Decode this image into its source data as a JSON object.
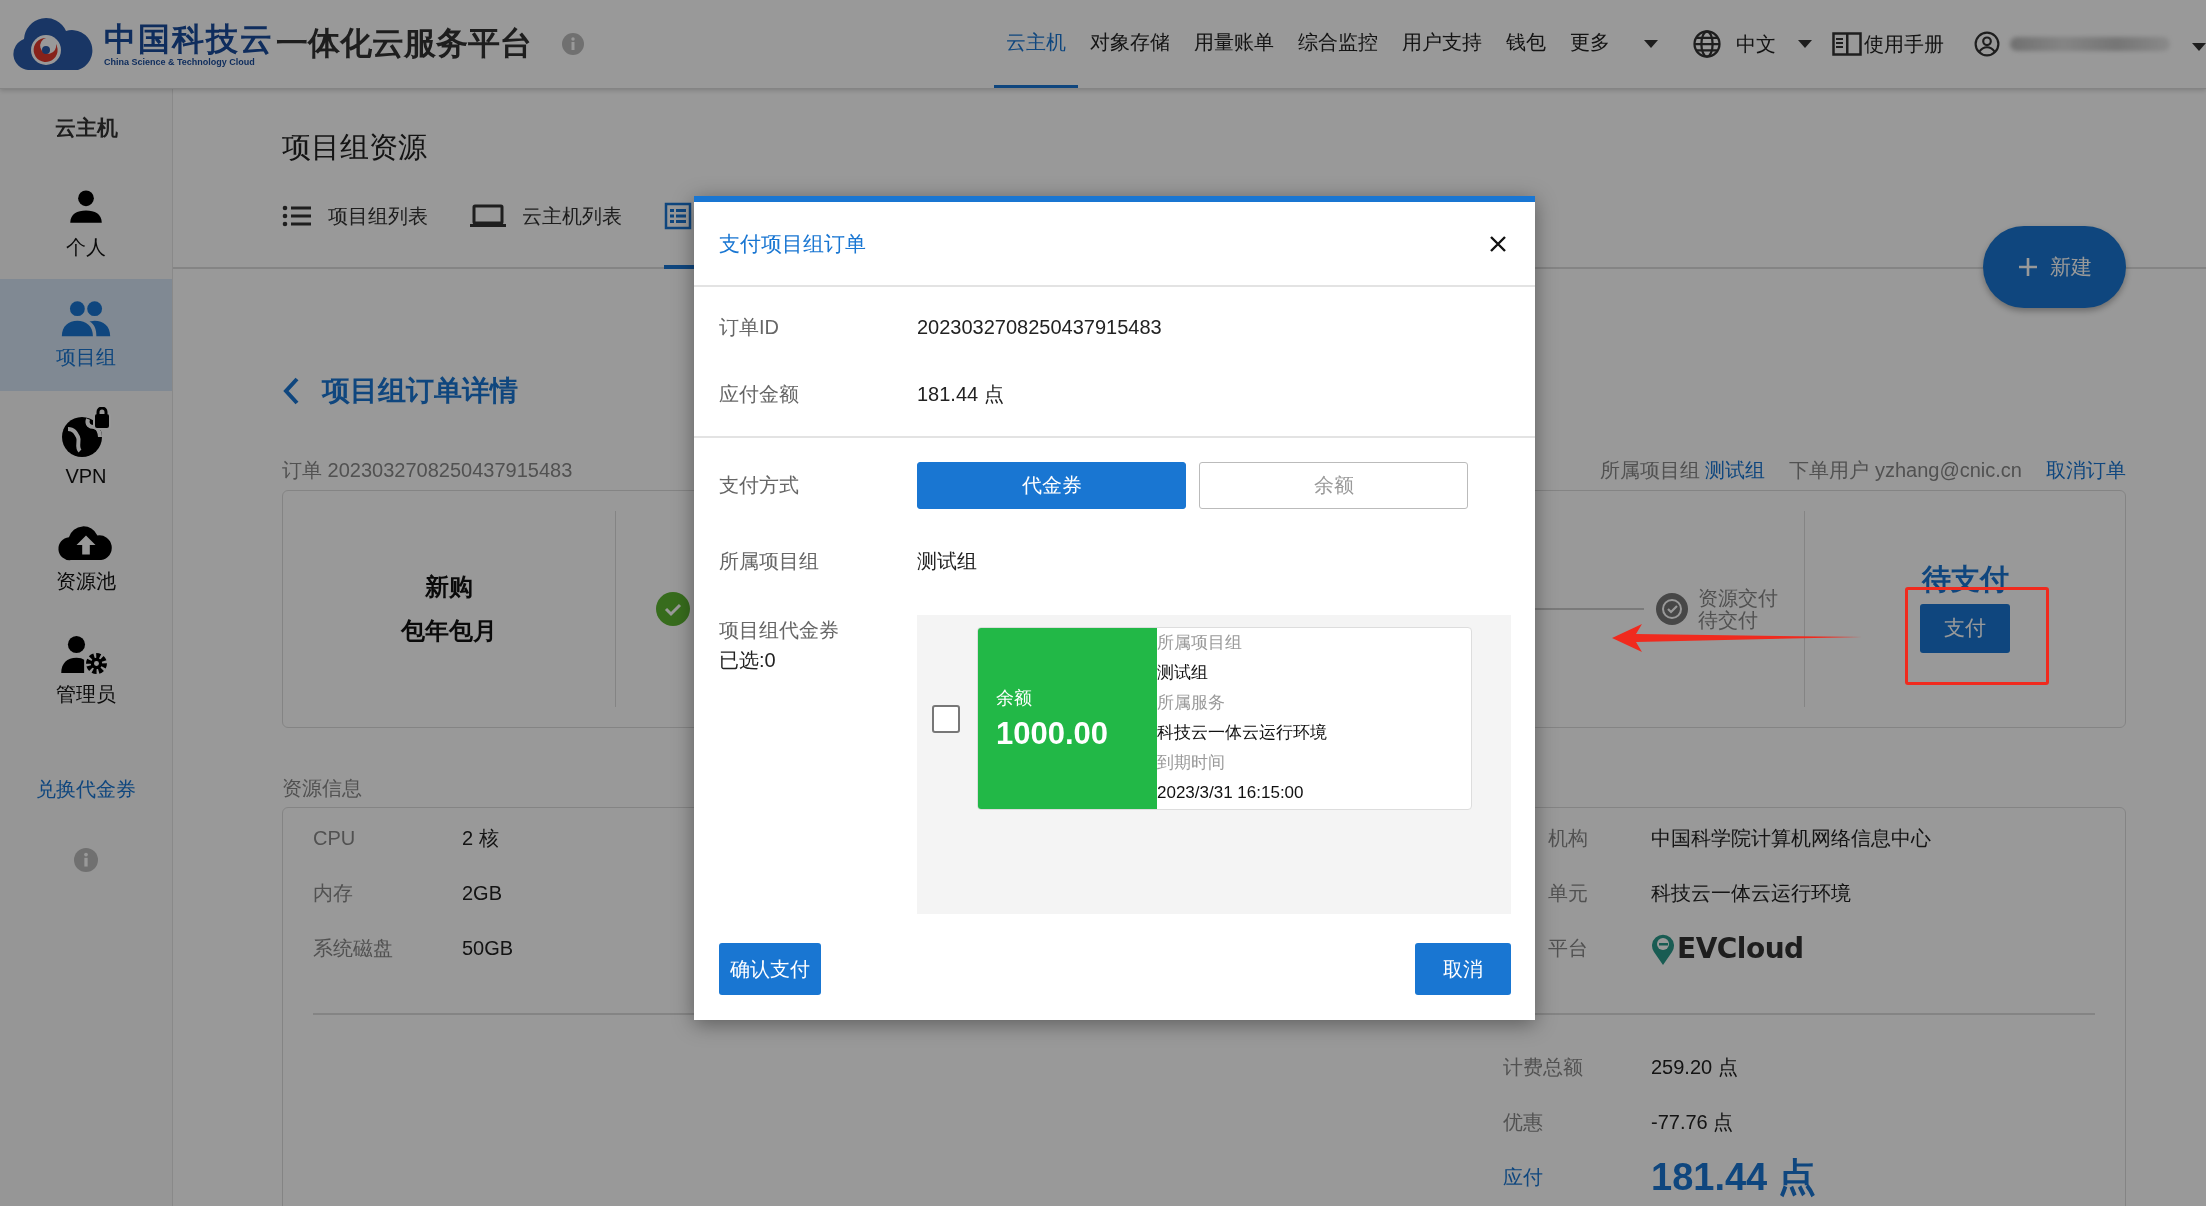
{
  "header": {
    "logo_title": "中国科技云",
    "logo_subtitle": "China Science & Technology Cloud",
    "platform": "一体化云服务平台",
    "nav": [
      {
        "label": "云主机",
        "selected": true
      },
      {
        "label": "对象存储",
        "selected": false
      },
      {
        "label": "用量账单",
        "selected": false
      },
      {
        "label": "综合监控",
        "selected": false
      },
      {
        "label": "用户支持",
        "selected": false
      },
      {
        "label": "钱包",
        "selected": false
      },
      {
        "label": "更多",
        "selected": false
      }
    ],
    "language": "中文",
    "manual": "使用手册"
  },
  "sidebar": {
    "title": "云主机",
    "items": [
      {
        "label": "个人",
        "kind": "person",
        "selected": false
      },
      {
        "label": "项目组",
        "kind": "group",
        "selected": true
      },
      {
        "label": "VPN",
        "kind": "vpn",
        "selected": false
      },
      {
        "label": "资源池",
        "kind": "pool",
        "selected": false
      },
      {
        "label": "管理员",
        "kind": "admin",
        "selected": false
      }
    ],
    "link": "兑换代金券"
  },
  "page": {
    "title": "项目组资源",
    "tabs": [
      {
        "label": "项目组列表",
        "kind": "list",
        "selected": false
      },
      {
        "label": "云主机列表",
        "kind": "laptop",
        "selected": false
      },
      {
        "kind": "table",
        "selected": true
      }
    ],
    "new_button": "新建",
    "heading": "项目组订单详情",
    "order": "订单 2023032708250437915483",
    "group_label": "所属项目组",
    "group": "测试组",
    "user_label": "下单用户",
    "user": "yzhang@cnic.cn",
    "cancel_order": "取消订单",
    "order_type": "新购",
    "billing": "包年包月",
    "steps": [
      {
        "kind": "done"
      },
      {
        "kind": "pending",
        "title": "资源交付",
        "status": "待交付"
      }
    ],
    "status": "待支付",
    "pay_button": "支付",
    "resource_title": "资源信息",
    "resources": [
      {
        "label": "CPU",
        "value": "2 核"
      },
      {
        "label": "内存",
        "value": "2GB"
      },
      {
        "label": "系统磁盘",
        "value": "50GB"
      }
    ],
    "details": [
      {
        "label": "机构",
        "value": "中国科学院计算机网络信息中心",
        "kind": "text"
      },
      {
        "label": "单元",
        "value": "科技云一体云运行环境",
        "kind": "text"
      },
      {
        "label": "平台",
        "value": "EVCloud",
        "kind": "logo"
      }
    ],
    "totals": [
      {
        "label": "计费总额",
        "value": "259.20 点",
        "kind": "normal"
      },
      {
        "label": "优惠",
        "value": "-77.76 点",
        "kind": "normal"
      },
      {
        "label": "应付",
        "value": "181.44 点",
        "kind": "big"
      }
    ]
  },
  "dialog": {
    "title": "支付项目组订单",
    "rows": [
      {
        "label": "订单ID",
        "value": "2023032708250437915483"
      },
      {
        "label": "应付金额",
        "value": "181.44 点"
      }
    ],
    "method_label": "支付方式",
    "methods": [
      {
        "label": "代金券",
        "selected": true
      },
      {
        "label": "余额",
        "selected": false
      }
    ],
    "group_label": "所属项目组",
    "group": "测试组",
    "voucher_label": "项目组代金券",
    "voucher_selected": "已选:0",
    "vouchers": [
      {
        "checked": false,
        "label": "余额",
        "amount": "1000.00",
        "details": [
          {
            "label": "所属项目组",
            "value": "测试组"
          },
          {
            "label": "所属服务",
            "value": "科技云一体云运行环境"
          },
          {
            "label": "到期时间",
            "value": "2023/3/31 16:15:00"
          }
        ]
      }
    ],
    "confirm": "确认支付",
    "cancel": "取消"
  }
}
